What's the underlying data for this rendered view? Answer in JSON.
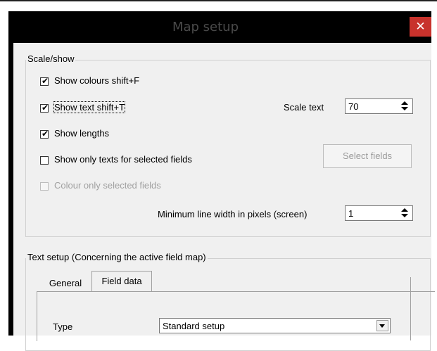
{
  "window": {
    "title": "Map setup",
    "close_symbol": "✕"
  },
  "scale_show": {
    "legend": "Scale/show",
    "show_colours": {
      "label": "Show colours  shift+F",
      "checked": true
    },
    "show_text": {
      "label": "Show text  shift+T",
      "checked": true
    },
    "scale_text": {
      "label": "Scale text",
      "value": "70"
    },
    "show_lengths": {
      "label": "Show lengths",
      "checked": true
    },
    "show_only_texts": {
      "label": "Show only texts for selected fields",
      "checked": false
    },
    "select_fields_label": "Select fields",
    "colour_only": {
      "label": "Colour only selected fields",
      "checked": false,
      "disabled": true
    },
    "min_line_width": {
      "label": "Minimum line width in pixels (screen)",
      "value": "1"
    }
  },
  "text_setup": {
    "legend": "Text setup  (Concerning the active field map)",
    "tabs": [
      {
        "label": "General",
        "active": false
      },
      {
        "label": "Field data",
        "active": true
      }
    ],
    "type": {
      "label": "Type",
      "value": "Standard setup"
    }
  }
}
